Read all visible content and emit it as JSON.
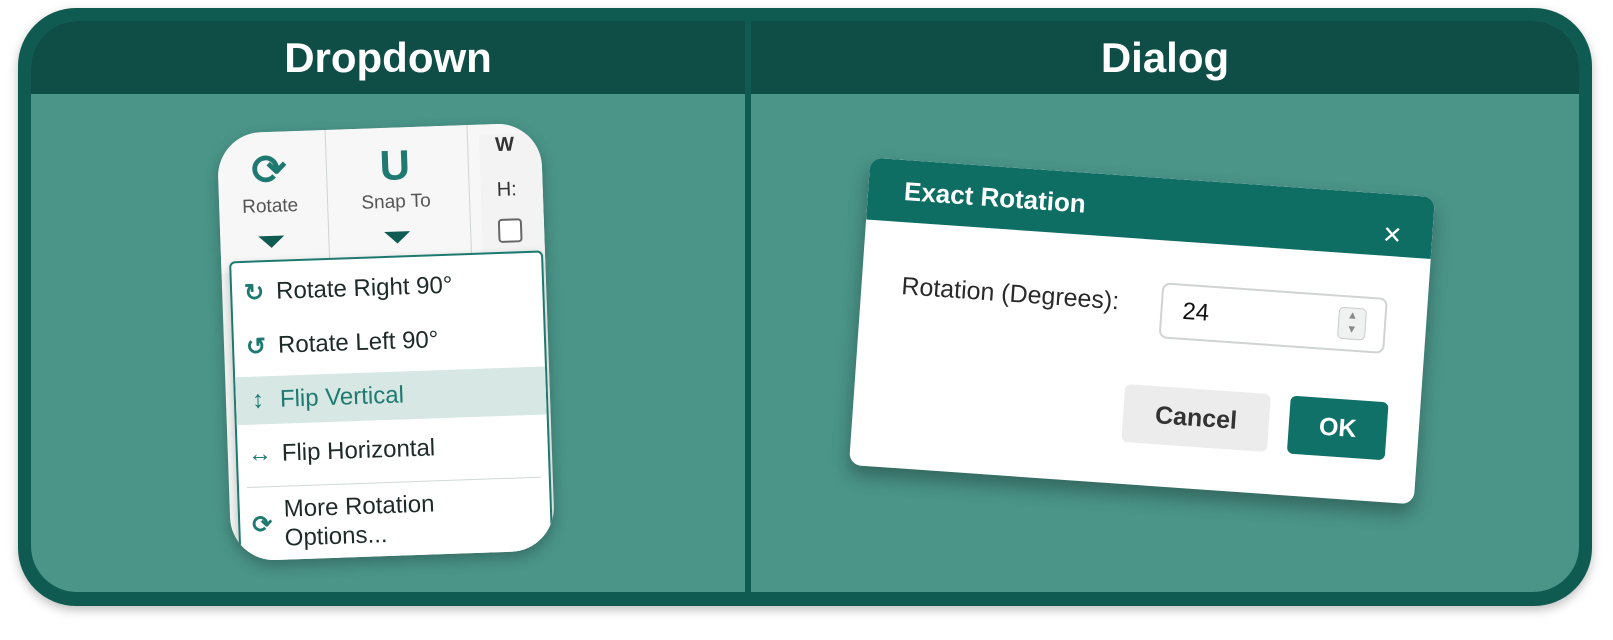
{
  "panels": {
    "dropdown": {
      "title": "Dropdown"
    },
    "dialog": {
      "title": "Dialog"
    }
  },
  "ribbon": {
    "rotate": {
      "label": "Rotate",
      "icon": "rotate-icon"
    },
    "snap": {
      "label": "Snap To",
      "icon": "magnet-icon"
    },
    "height_label": "H:"
  },
  "menu": {
    "items": [
      {
        "label": "Rotate Right 90°",
        "icon": "rotate-right-icon"
      },
      {
        "label": "Rotate Left 90°",
        "icon": "rotate-left-icon"
      },
      {
        "label": "Flip Vertical",
        "icon": "flip-vertical-icon",
        "highlighted": true
      },
      {
        "label": "Flip Horizontal",
        "icon": "flip-horizontal-icon"
      },
      {
        "label": "More Rotation Options...",
        "icon": "rotate-options-icon"
      }
    ]
  },
  "dialog": {
    "title": "Exact Rotation",
    "field_label": "Rotation (Degrees):",
    "rotation_value": "24",
    "cancel": "Cancel",
    "ok": "OK"
  },
  "colors": {
    "frame": "#0f5b52",
    "panel": "#4a9488",
    "header": "#0f4e47",
    "accent": "#1e7a70"
  }
}
